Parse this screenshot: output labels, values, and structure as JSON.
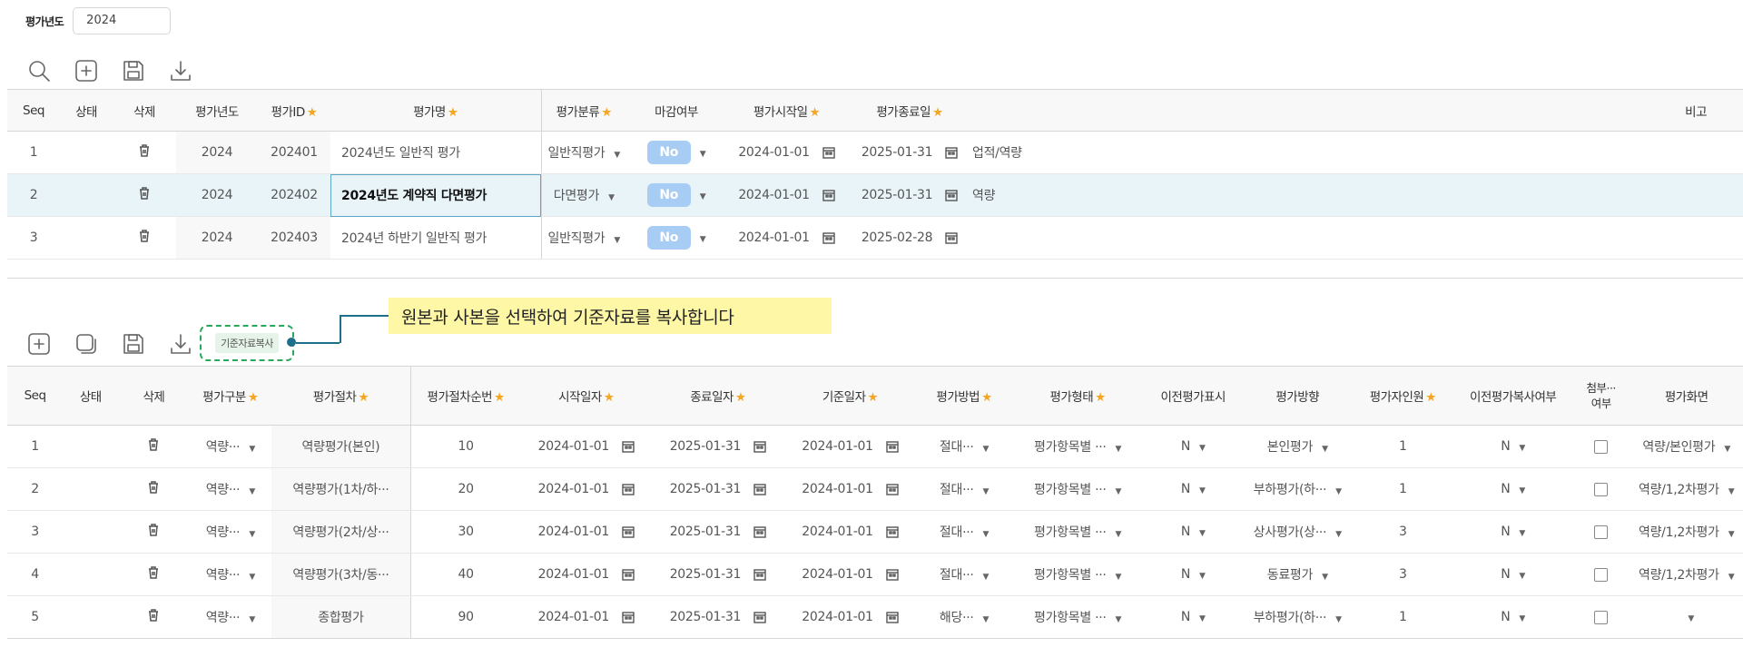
{
  "filter": {
    "label": "평가년도",
    "value": "2024"
  },
  "toolbar1": {
    "icons": [
      "search-icon",
      "add-icon",
      "save-icon",
      "download-icon"
    ]
  },
  "toolbar2": {
    "icons": [
      "add-icon",
      "copy-icon",
      "save-icon",
      "download-icon"
    ],
    "copy_base_label": "기준자료복사"
  },
  "callout": {
    "text": "원본과 사본을 선택하여 기준자료를 복사합니다"
  },
  "grid1": {
    "headers": {
      "seq": "Seq",
      "status": "상태",
      "delete": "삭제",
      "year": "평가년도",
      "id": "평가ID",
      "name": "평가명",
      "category": "평가분류",
      "closed": "마감여부",
      "start": "평가시작일",
      "end": "평가종료일",
      "note": "비고"
    },
    "rows": [
      {
        "seq": "1",
        "year": "2024",
        "id": "202401",
        "name": "2024년도 일반직 평가",
        "category": "일반직평가",
        "closed": "No",
        "start": "2024-01-01",
        "end": "2025-01-31",
        "extra": "업적/역량"
      },
      {
        "seq": "2",
        "year": "2024",
        "id": "202402",
        "name": "2024년도 계약직 다면평가",
        "category": "다면평가",
        "closed": "No",
        "start": "2024-01-01",
        "end": "2025-01-31",
        "extra": "역량"
      },
      {
        "seq": "3",
        "year": "2024",
        "id": "202403",
        "name": "2024년 하반기 일반직 평가",
        "category": "일반직평가",
        "closed": "No",
        "start": "2024-01-01",
        "end": "2025-02-28",
        "extra": ""
      }
    ]
  },
  "grid2": {
    "headers": {
      "seq": "Seq",
      "status": "상태",
      "delete": "삭제",
      "type": "평가구분",
      "step": "평가절차",
      "order": "평가절차순번",
      "start": "시작일자",
      "end": "종료일자",
      "base": "기준일자",
      "method": "평가방법",
      "form": "평가형태",
      "prev_show": "이전평가표시",
      "direction": "평가방향",
      "raters": "평가자인원",
      "prev_copy": "이전평가복사여부",
      "attach_1": "첨부···",
      "attach_2": "여부",
      "screen": "평가화면"
    },
    "rows": [
      {
        "seq": "1",
        "type": "역량···",
        "step": "역량평가(본인)",
        "order": "10",
        "start": "2024-01-01",
        "end": "2025-01-31",
        "base": "2024-01-01",
        "method": "절대···",
        "form": "평가항목별 ···",
        "prev_show": "N",
        "direction": "본인평가",
        "raters": "1",
        "prev_copy": "N",
        "screen": "역량/본인평가"
      },
      {
        "seq": "2",
        "type": "역량···",
        "step": "역량평가(1차/하···",
        "order": "20",
        "start": "2024-01-01",
        "end": "2025-01-31",
        "base": "2024-01-01",
        "method": "절대···",
        "form": "평가항목별 ···",
        "prev_show": "N",
        "direction": "부하평가(하···",
        "raters": "1",
        "prev_copy": "N",
        "screen": "역량/1,2차평가"
      },
      {
        "seq": "3",
        "type": "역량···",
        "step": "역량평가(2차/상···",
        "order": "30",
        "start": "2024-01-01",
        "end": "2025-01-31",
        "base": "2024-01-01",
        "method": "절대···",
        "form": "평가항목별 ···",
        "prev_show": "N",
        "direction": "상사평가(상···",
        "raters": "3",
        "prev_copy": "N",
        "screen": "역량/1,2차평가"
      },
      {
        "seq": "4",
        "type": "역량···",
        "step": "역량평가(3차/동···",
        "order": "40",
        "start": "2024-01-01",
        "end": "2025-01-31",
        "base": "2024-01-01",
        "method": "절대···",
        "form": "평가항목별 ···",
        "prev_show": "N",
        "direction": "동료평가",
        "raters": "3",
        "prev_copy": "N",
        "screen": "역량/1,2차평가"
      },
      {
        "seq": "5",
        "type": "역량···",
        "step": "종합평가",
        "order": "90",
        "start": "2024-01-01",
        "end": "2025-01-31",
        "base": "2024-01-01",
        "method": "해당···",
        "form": "평가항목별 ···",
        "prev_show": "N",
        "direction": "부하평가(하···",
        "raters": "1",
        "prev_copy": "N",
        "screen": ""
      }
    ]
  }
}
